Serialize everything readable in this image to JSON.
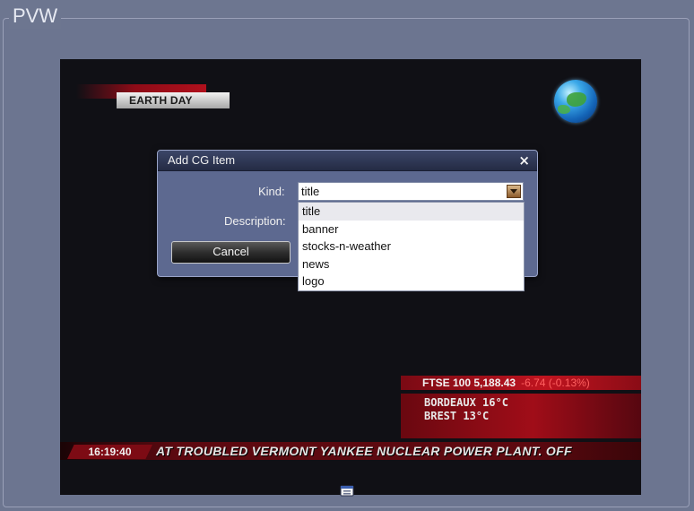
{
  "panel": {
    "title": "PVW"
  },
  "preview": {
    "earth_day_label": "EARTH DAY",
    "ftse": {
      "name": "FTSE 100 5,188.43",
      "change": "-6.74 (-0.13%)"
    },
    "weather": [
      "BORDEAUX 16°C",
      "BREST  13°C"
    ],
    "clock": "16:19:40",
    "ticker": "AT TROUBLED VERMONT YANKEE NUCLEAR POWER PLANT.     OFF"
  },
  "dialog": {
    "title": "Add CG Item",
    "close_label": "×",
    "kind_label": "Kind:",
    "kind_value": "title",
    "description_label": "Description:",
    "cancel_label": "Cancel",
    "kind_options": [
      "title",
      "banner",
      "stocks-n-weather",
      "news",
      "logo"
    ],
    "selected_index": 0
  },
  "colors": {
    "background": "#6d7690",
    "dialog": "#5d6990",
    "ticker_red": "#7d0b14"
  },
  "icons": {
    "globe": "globe-icon",
    "dropdown": "chevron-down-icon",
    "bottom": "window-icon"
  }
}
